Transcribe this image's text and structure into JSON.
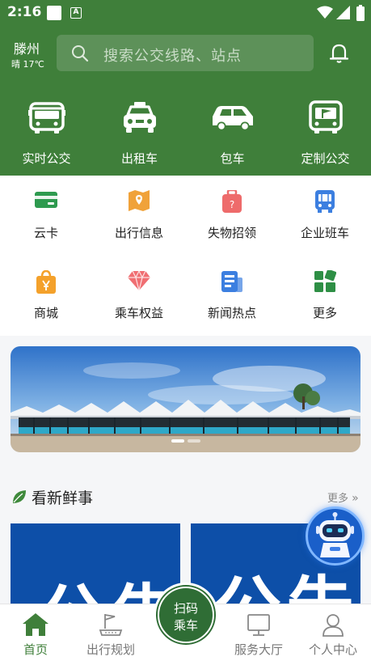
{
  "status_bar": {
    "time": "2:16"
  },
  "header": {
    "city": "滕州",
    "weather": "晴 17℃",
    "search_placeholder": "搜索公交线路、站点"
  },
  "main_nav": [
    {
      "label": "实时公交",
      "icon": "bus-icon"
    },
    {
      "label": "出租车",
      "icon": "taxi-icon"
    },
    {
      "label": "包车",
      "icon": "charter-car-icon"
    },
    {
      "label": "定制公交",
      "icon": "custom-bus-icon"
    }
  ],
  "grid": [
    {
      "label": "云卡",
      "icon": "card-icon",
      "color": "#2e9a4f"
    },
    {
      "label": "出行信息",
      "icon": "map-icon",
      "color": "#f0a23a"
    },
    {
      "label": "失物招领",
      "icon": "luggage-icon",
      "color": "#ee6b6b"
    },
    {
      "label": "企业班车",
      "icon": "shuttle-icon",
      "color": "#3c7fe0"
    },
    {
      "label": "商城",
      "icon": "shopping-bag-icon",
      "color": "#f4a12b"
    },
    {
      "label": "乘车权益",
      "icon": "diamond-icon",
      "color": "#f06e72"
    },
    {
      "label": "新闻热点",
      "icon": "news-icon",
      "color": "#3c7fe0"
    },
    {
      "label": "更多",
      "icon": "more-grid-icon",
      "color": "#2e8f45"
    }
  ],
  "banner": {
    "slides": 2,
    "active": 0
  },
  "news": {
    "title": "看新鲜事",
    "more": "更多",
    "cards": [
      "公告",
      "公告"
    ]
  },
  "tabbar": {
    "tabs": [
      {
        "label": "首页",
        "icon": "home-icon",
        "active": true
      },
      {
        "label": "出行规划",
        "icon": "route-plan-icon",
        "active": false
      },
      {
        "label": "服务大厅",
        "icon": "service-hall-icon",
        "active": false
      },
      {
        "label": "个人中心",
        "icon": "user-icon",
        "active": false
      }
    ],
    "scan": {
      "line1": "扫码",
      "line2": "乘车"
    }
  },
  "colors": {
    "primary": "#3f7f3a",
    "scan_button": "#2f6d35",
    "news_card": "#0d4fa8"
  }
}
